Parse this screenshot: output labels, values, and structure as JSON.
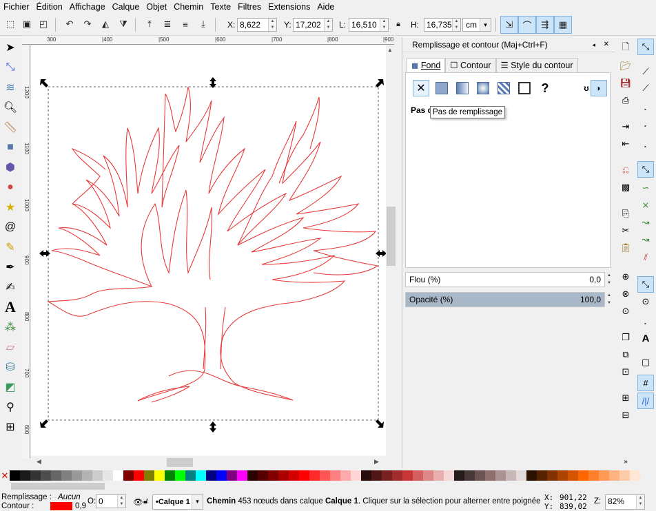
{
  "menu": [
    "Fichier",
    "Édition",
    "Affichage",
    "Calque",
    "Objet",
    "Chemin",
    "Texte",
    "Filtres",
    "Extensions",
    "Aide"
  ],
  "toolbar": {
    "x_label": "X:",
    "x_value": "8,622",
    "y_label": "Y:",
    "y_value": "17,202",
    "w_label": "L:",
    "w_value": "16,510",
    "h_label": "H:",
    "h_value": "16,735",
    "unit": "cm"
  },
  "rulers": {
    "top": [
      "300",
      "|400",
      "|500",
      "|600",
      "|700",
      "|800",
      "|900"
    ],
    "left": [
      "1200",
      "1100",
      "1000",
      "900",
      "800",
      "700",
      "600"
    ]
  },
  "dialog": {
    "title": "Remplissage et contour (Maj+Ctrl+F)",
    "tabs": [
      "Fond",
      "Contour",
      "Style du contour"
    ],
    "no_paint_label": "Pas d",
    "tooltip": "Pas de remplissage",
    "blur_label": "Flou (%)",
    "blur_value": "0,0",
    "blur": 0,
    "opacity_label": "Opacité (%)",
    "opacity_value": "100,0",
    "opacity": 100
  },
  "palette_colors": [
    "#000000",
    "#1a1a1a",
    "#333333",
    "#4d4d4d",
    "#666666",
    "#808080",
    "#999999",
    "#b3b3b3",
    "#cccccc",
    "#e6e6e6",
    "#ffffff",
    "#800000",
    "#ff0000",
    "#808000",
    "#ffff00",
    "#008000",
    "#00ff00",
    "#008080",
    "#00ffff",
    "#000080",
    "#0000ff",
    "#800080",
    "#ff00ff",
    "#2b0000",
    "#550000",
    "#800000",
    "#aa0000",
    "#d40000",
    "#ff0000",
    "#ff2a2a",
    "#ff5555",
    "#ff8080",
    "#ffaaaa",
    "#ffd5d5",
    "#280b0b",
    "#501616",
    "#782121",
    "#a02c2c",
    "#c83737",
    "#d35f5f",
    "#de8787",
    "#e9afaf",
    "#f4d7d7",
    "#241c1c",
    "#483737",
    "#6c5353",
    "#916f6f",
    "#ac9393",
    "#c8b7b7",
    "#e3dbdb",
    "#2b1100",
    "#552200",
    "#803300",
    "#aa4400",
    "#d45500",
    "#ff6600",
    "#ff7f2a",
    "#ff9955",
    "#ffb380",
    "#ffccaa",
    "#ffe6d5"
  ],
  "status": {
    "fill_label": "Remplissage :",
    "fill_value": "Aucun",
    "stroke_label": "Contour :",
    "stroke_color": "#ff0000",
    "stroke_width": "0,9",
    "opacity_label": "O:",
    "opacity_value": "0",
    "layer": "•Calque 1",
    "message_bold": "Chemin",
    "message": " 453 nœuds dans calque ",
    "message_layer": "Calque 1",
    "message_end": ". Cliquer sur la sélection pour alterner entre poignées",
    "x_label": "X:",
    "x_value": "901,22",
    "y_label": "Y:",
    "y_value": "839,02",
    "zoom_label": "Z:",
    "zoom_value": "82%"
  }
}
